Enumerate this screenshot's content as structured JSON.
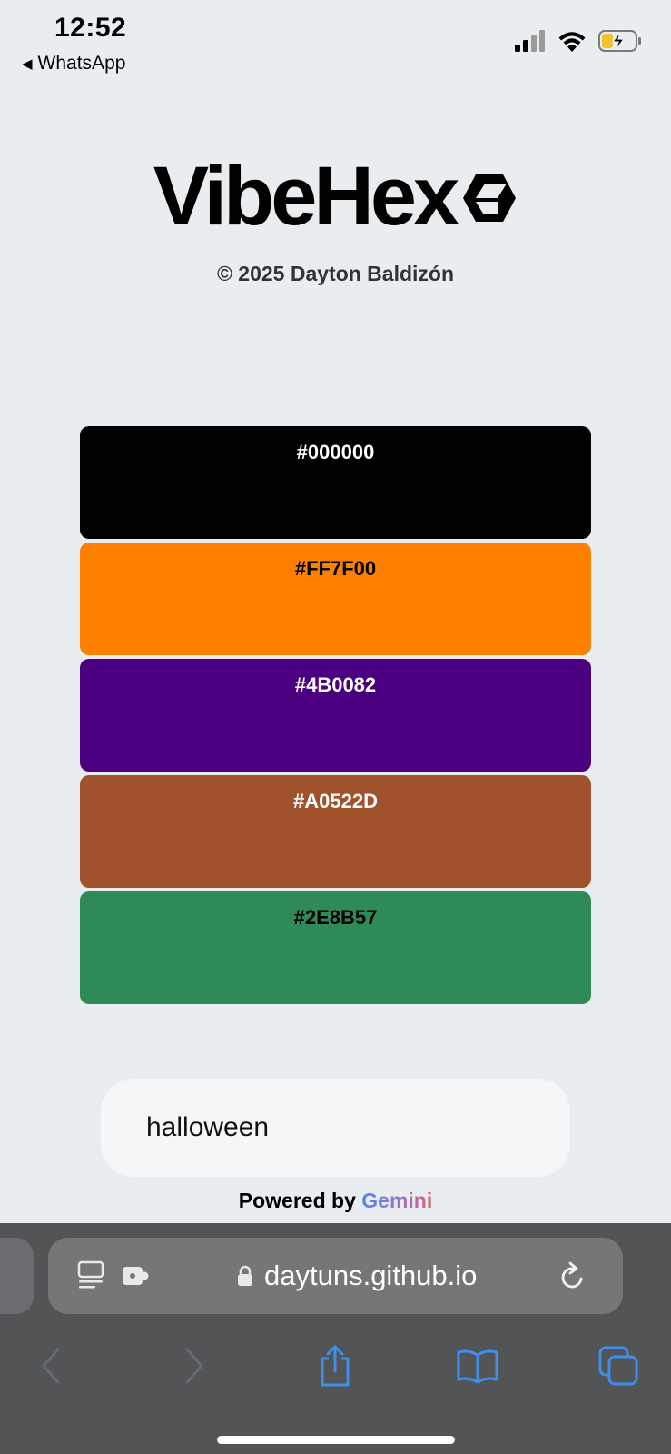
{
  "status_bar": {
    "time": "12:52",
    "back_label": "WhatsApp",
    "icons": [
      "signal-icon",
      "wifi-icon",
      "battery-charging-icon"
    ]
  },
  "header": {
    "brand": "VibeHex",
    "logo_icon": "hexagon-cube-icon",
    "copyright": "© 2025 Dayton Baldizón"
  },
  "palette": [
    {
      "hex": "#000000",
      "color": "#000000",
      "text_color": "#ffffff"
    },
    {
      "hex": "#FF7F00",
      "color": "#FF7F00",
      "text_color": "#000000"
    },
    {
      "hex": "#4B0082",
      "color": "#4B0082",
      "text_color": "#ffffff"
    },
    {
      "hex": "#A0522D",
      "color": "#A0522D",
      "text_color": "#ffffff"
    },
    {
      "hex": "#2E8B57",
      "color": "#2E8B57",
      "text_color": "#000000"
    }
  ],
  "prompt": {
    "value": "halloween"
  },
  "footer": {
    "powered_prefix": "Powered by",
    "powered_brand": "Gemini"
  },
  "browser": {
    "url": "daytuns.github.io",
    "icons": [
      "reader-icon",
      "extension-icon",
      "lock-icon",
      "reload-icon",
      "back-icon",
      "forward-icon",
      "share-icon",
      "bookmarks-icon",
      "tabs-icon"
    ]
  },
  "colors": {
    "background": "#eaedf0",
    "browser_chrome": "#525456",
    "address_bar": "#747678",
    "toolbar_accent": "#3e8eea"
  }
}
